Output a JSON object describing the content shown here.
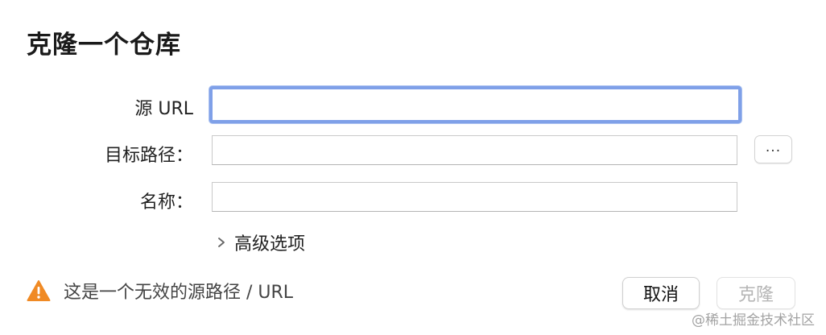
{
  "dialog": {
    "title": "克隆一个仓库"
  },
  "form": {
    "source_url_label": "源 URL",
    "source_url_value": "",
    "target_path_label": "目标路径：",
    "target_path_value": "",
    "browse_label": "...",
    "name_label": "名称：",
    "name_value": "",
    "advanced_label": "高级选项"
  },
  "status": {
    "warning_text": "这是一个无效的源路径 / URL",
    "warning_color": "#f08a24"
  },
  "buttons": {
    "cancel_label": "取消",
    "clone_label": "克隆"
  },
  "watermark": {
    "text": "@稀土掘金技术社区"
  },
  "colors": {
    "focus_ring": "#7fa0e8",
    "disabled_text": "#b5b5b5"
  }
}
